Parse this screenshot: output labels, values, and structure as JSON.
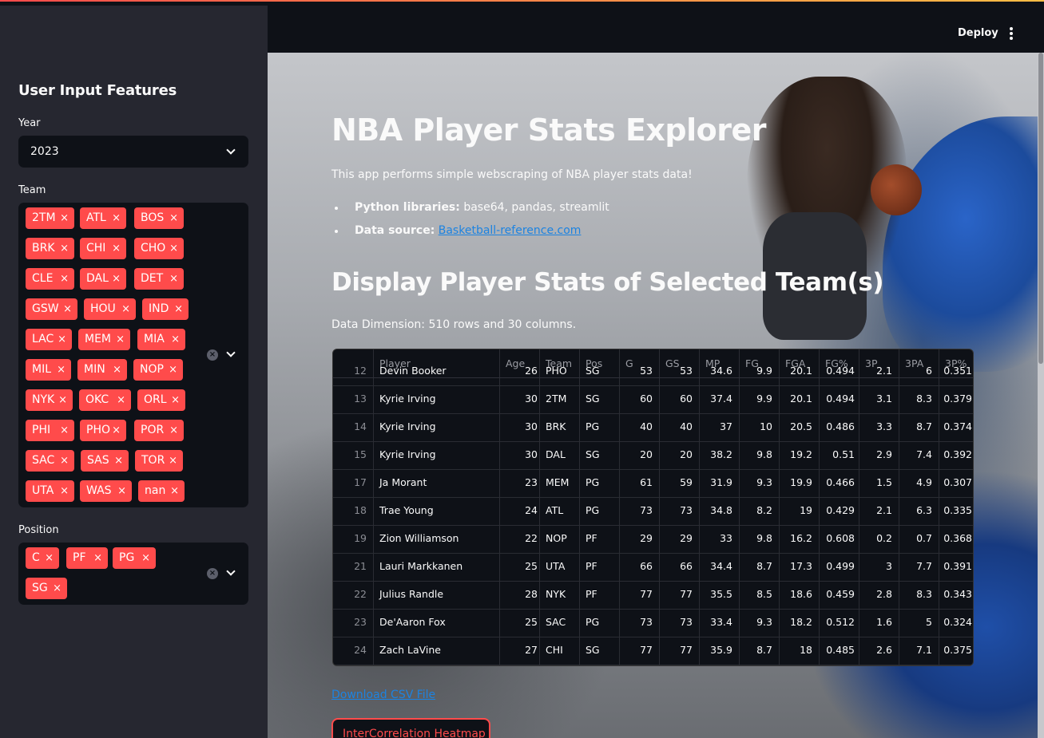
{
  "header": {
    "deploy_label": "Deploy"
  },
  "sidebar": {
    "title": "User Input Features",
    "year": {
      "label": "Year",
      "value": "2023"
    },
    "team": {
      "label": "Team",
      "tags": [
        "2TM",
        "ATL",
        "BOS",
        "BRK",
        "CHI",
        "CHO",
        "CLE",
        "DAL",
        "DET",
        "GSW",
        "HOU",
        "IND",
        "LAC",
        "MEM",
        "MIA",
        "MIL",
        "MIN",
        "NOP",
        "NYK",
        "OKC",
        "ORL",
        "PHI",
        "PHO",
        "POR",
        "SAC",
        "SAS",
        "TOR",
        "UTA",
        "WAS",
        "nan"
      ]
    },
    "position": {
      "label": "Position",
      "tags": [
        "C",
        "PF",
        "PG",
        "SG"
      ]
    }
  },
  "main": {
    "title": "NBA Player Stats Explorer",
    "intro": "This app performs simple webscraping of NBA player stats data!",
    "libraries_label": "Python libraries:",
    "libraries_value": "base64, pandas, streamlit",
    "source_label": "Data source:",
    "source_link": "Basketball-reference.com",
    "section_title": "Display Player Stats of Selected Team(s)",
    "dimension_text": "Data Dimension: 510 rows and 30 columns.",
    "download_link": "Download CSV File",
    "heatmap_button": "InterCorrelation Heatmap"
  },
  "table": {
    "columns": [
      "Player",
      "Age",
      "Team",
      "Pos",
      "G",
      "GS",
      "MP",
      "FG",
      "FGA",
      "FG%",
      "3P",
      "3PA",
      "3P%"
    ],
    "rows": [
      [
        "12",
        "Devin Booker",
        "26",
        "PHO",
        "SG",
        "53",
        "53",
        "34.6",
        "9.9",
        "20.1",
        "0.494",
        "2.1",
        "6",
        "0.351"
      ],
      [
        "13",
        "Kyrie Irving",
        "30",
        "2TM",
        "SG",
        "60",
        "60",
        "37.4",
        "9.9",
        "20.1",
        "0.494",
        "3.1",
        "8.3",
        "0.379"
      ],
      [
        "14",
        "Kyrie Irving",
        "30",
        "BRK",
        "PG",
        "40",
        "40",
        "37",
        "10",
        "20.5",
        "0.486",
        "3.3",
        "8.7",
        "0.374"
      ],
      [
        "15",
        "Kyrie Irving",
        "30",
        "DAL",
        "SG",
        "20",
        "20",
        "38.2",
        "9.8",
        "19.2",
        "0.51",
        "2.9",
        "7.4",
        "0.392"
      ],
      [
        "17",
        "Ja Morant",
        "23",
        "MEM",
        "PG",
        "61",
        "59",
        "31.9",
        "9.3",
        "19.9",
        "0.466",
        "1.5",
        "4.9",
        "0.307"
      ],
      [
        "18",
        "Trae Young",
        "24",
        "ATL",
        "PG",
        "73",
        "73",
        "34.8",
        "8.2",
        "19",
        "0.429",
        "2.1",
        "6.3",
        "0.335"
      ],
      [
        "19",
        "Zion Williamson",
        "22",
        "NOP",
        "PF",
        "29",
        "29",
        "33",
        "9.8",
        "16.2",
        "0.608",
        "0.2",
        "0.7",
        "0.368"
      ],
      [
        "21",
        "Lauri Markkanen",
        "25",
        "UTA",
        "PF",
        "66",
        "66",
        "34.4",
        "8.7",
        "17.3",
        "0.499",
        "3",
        "7.7",
        "0.391"
      ],
      [
        "22",
        "Julius Randle",
        "28",
        "NYK",
        "PF",
        "77",
        "77",
        "35.5",
        "8.5",
        "18.6",
        "0.459",
        "2.8",
        "8.3",
        "0.343"
      ],
      [
        "23",
        "De'Aaron Fox",
        "25",
        "SAC",
        "PG",
        "73",
        "73",
        "33.4",
        "9.3",
        "18.2",
        "0.512",
        "1.6",
        "5",
        "0.324"
      ],
      [
        "24",
        "Zach LaVine",
        "27",
        "CHI",
        "SG",
        "77",
        "77",
        "35.9",
        "8.7",
        "18",
        "0.485",
        "2.6",
        "7.1",
        "0.375"
      ]
    ]
  }
}
